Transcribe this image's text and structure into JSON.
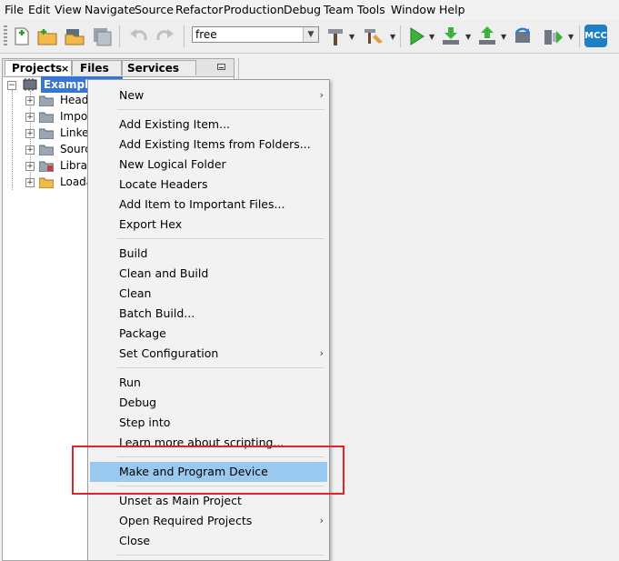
{
  "menubar": [
    "File",
    "Edit",
    "View",
    "Navigate",
    "Source",
    "Refactor",
    "Production",
    "Debug",
    "Team",
    "Tools",
    "Window",
    "Help"
  ],
  "toolbar": {
    "config_value": "free",
    "mcc_label": "MCC",
    "icons": [
      "new-file-icon",
      "new-project-icon",
      "open-project-icon",
      "save-all-icon",
      "undo-icon",
      "redo-icon",
      "build-hammer-icon",
      "clean-build-icon",
      "run-icon",
      "debug-download-icon",
      "upload-icon",
      "refresh-icon",
      "make-program-icon",
      "mcc-icon"
    ]
  },
  "panel": {
    "tabs": [
      "Projects",
      "Files",
      "Services"
    ],
    "project_name": "Example Project",
    "tree": [
      "Heade",
      "Impor",
      "Linker",
      "Source",
      "Librari",
      "Loada"
    ]
  },
  "context_menu": {
    "items": [
      {
        "label": "New",
        "submenu": true
      },
      {
        "label": "Add Existing Item..."
      },
      {
        "label": "Add Existing Items from Folders..."
      },
      {
        "label": "New Logical Folder"
      },
      {
        "label": "Locate Headers"
      },
      {
        "label": "Add Item to Important Files..."
      },
      {
        "label": "Export Hex"
      },
      {
        "label": "Build"
      },
      {
        "label": "Clean and Build"
      },
      {
        "label": "Clean"
      },
      {
        "label": "Batch Build..."
      },
      {
        "label": "Package"
      },
      {
        "label": "Set Configuration",
        "submenu": true
      },
      {
        "label": "Run"
      },
      {
        "label": "Debug"
      },
      {
        "label": "Step into"
      },
      {
        "label": "Learn more about scripting..."
      },
      {
        "label": "Make and Program Device",
        "highlighted": true
      },
      {
        "label": "Unset as Main Project"
      },
      {
        "label": "Open Required Projects",
        "submenu": true
      },
      {
        "label": "Close"
      }
    ],
    "submenu_glyph": "›"
  },
  "colors": {
    "highlight": "#99c9ef",
    "annotation": "#e0232b",
    "selection": "#3875d7"
  }
}
